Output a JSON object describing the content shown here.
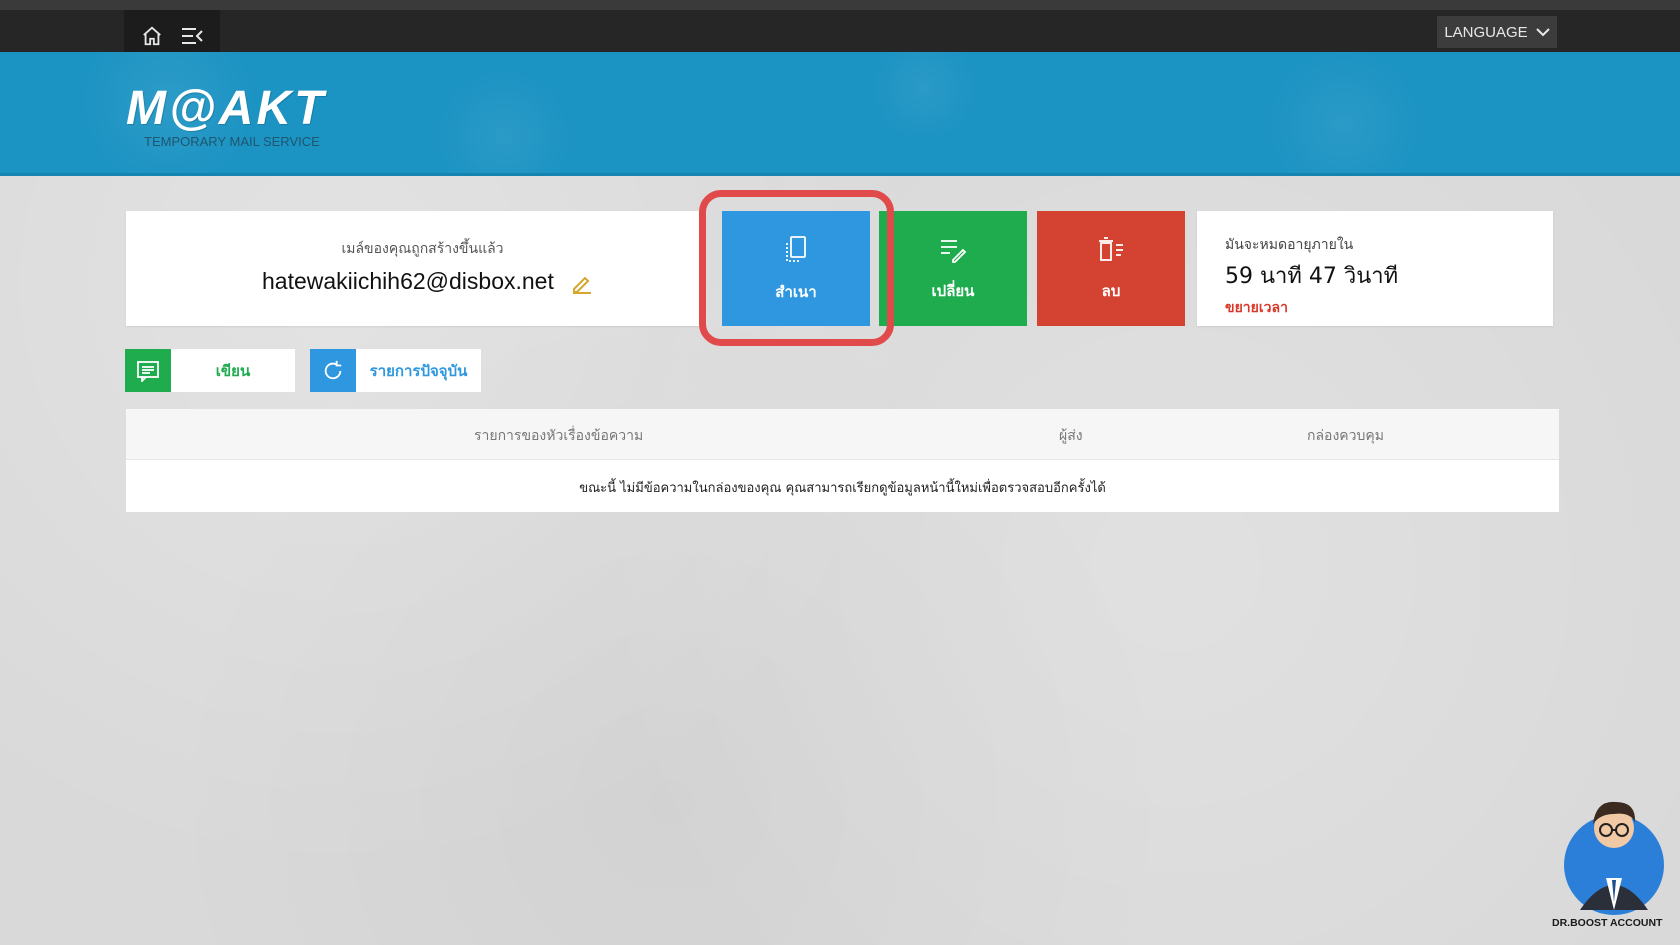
{
  "topbar": {
    "home_icon": "home-icon",
    "menu_icon": "menu-collapse-icon",
    "language_label": "LANGUAGE"
  },
  "brand": {
    "logo_text": "M@AKT",
    "tagline": "TEMPORARY MAIL SERVICE"
  },
  "mailbox": {
    "caption": "เมล์ของคุณถูกสร้างขึ้นแล้ว",
    "address": "hatewakiichih62@disbox.net",
    "edit_icon": "pencil-icon"
  },
  "actions": {
    "copy_label": "สำเนา",
    "change_label": "เปลี่ยน",
    "delete_label": "ลบ"
  },
  "timer": {
    "caption": "มันจะหมดอายุภายใน",
    "value": "59 นาที 47 วินาที",
    "extend_label": "ขยายเวลา"
  },
  "toolbar": {
    "write_label": "เขียน",
    "refresh_label": "รายการปัจจุบัน"
  },
  "inbox": {
    "columns": [
      "รายการของหัวเรื่องข้อความ",
      "ผู้ส่ง",
      "กล่องควบคุม"
    ],
    "empty_message": "ขณะนี้ ไม่มีข้อความในกล่องของคุณ คุณสามารถเรียกดูข้อมูลหน้านี้ใหม่เพื่อตรวจสอบอีกครั้งได้"
  },
  "watermark": {
    "label": "DR.BOOST ACCOUNT"
  },
  "colors": {
    "banner": "#1b93c3",
    "copy": "#2f97e0",
    "change": "#1fac4f",
    "delete": "#d44332",
    "highlight": "#e04a4a"
  }
}
